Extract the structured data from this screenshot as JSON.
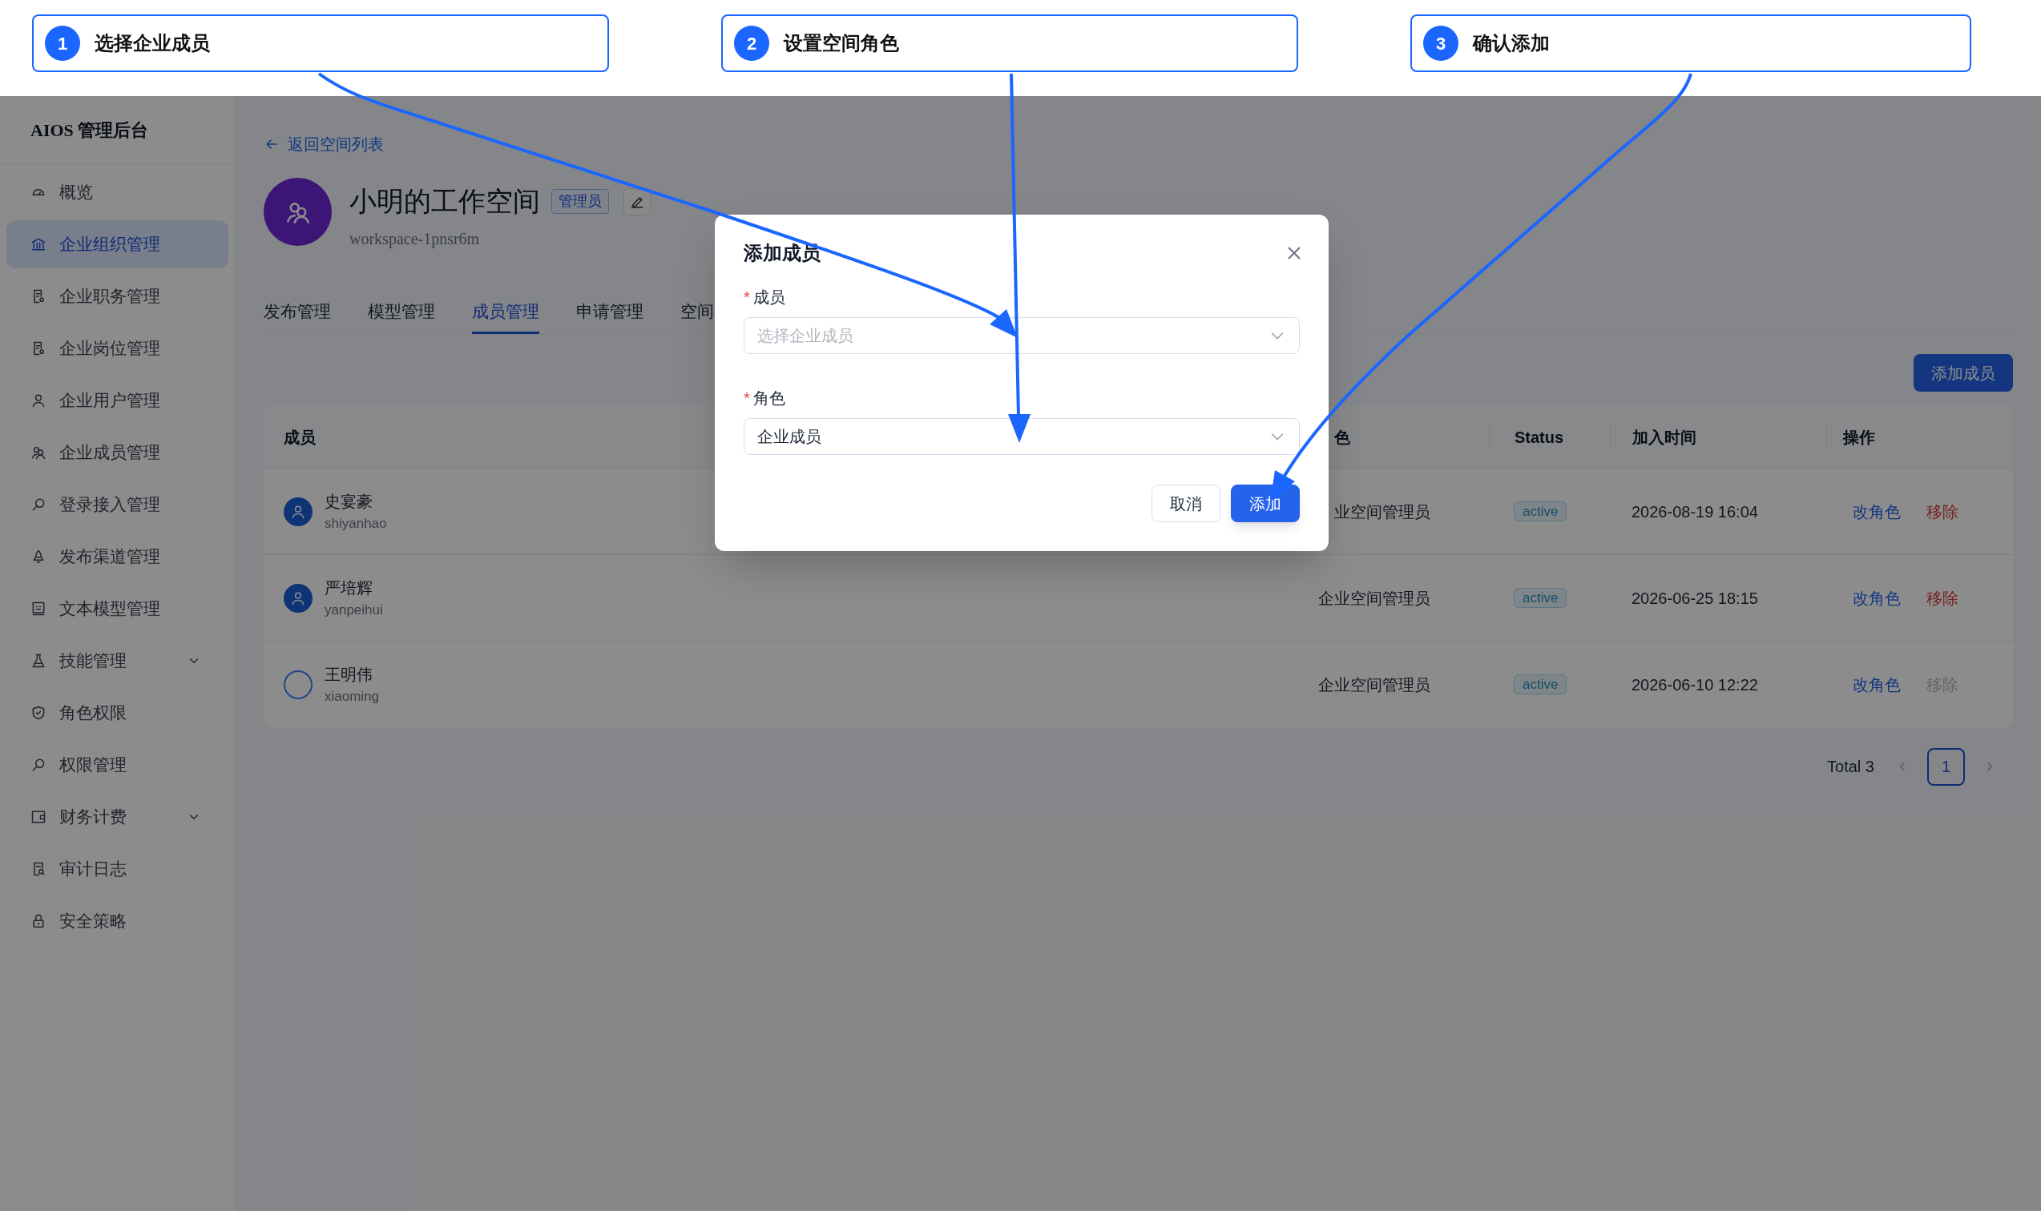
{
  "annotations": [
    {
      "number": "1",
      "label": "选择企业成员"
    },
    {
      "number": "2",
      "label": "设置空间角色"
    },
    {
      "number": "3",
      "label": "确认添加"
    }
  ],
  "sidebar": {
    "title": "AIOS 管理后台",
    "items": [
      {
        "label": "概览",
        "selected": false,
        "has_submenu": false
      },
      {
        "label": "企业组织管理",
        "selected": true,
        "has_submenu": false
      },
      {
        "label": "企业职务管理",
        "selected": false,
        "has_submenu": false
      },
      {
        "label": "企业岗位管理",
        "selected": false,
        "has_submenu": false
      },
      {
        "label": "企业用户管理",
        "selected": false,
        "has_submenu": false
      },
      {
        "label": "企业成员管理",
        "selected": false,
        "has_submenu": false
      },
      {
        "label": "登录接入管理",
        "selected": false,
        "has_submenu": false
      },
      {
        "label": "发布渠道管理",
        "selected": false,
        "has_submenu": false
      },
      {
        "label": "文本模型管理",
        "selected": false,
        "has_submenu": false
      },
      {
        "label": "技能管理",
        "selected": false,
        "has_submenu": true
      },
      {
        "label": "角色权限",
        "selected": false,
        "has_submenu": false
      },
      {
        "label": "权限管理",
        "selected": false,
        "has_submenu": false
      },
      {
        "label": "财务计费",
        "selected": false,
        "has_submenu": true
      },
      {
        "label": "审计日志",
        "selected": false,
        "has_submenu": false
      },
      {
        "label": "安全策略",
        "selected": false,
        "has_submenu": false
      }
    ]
  },
  "back_link": "返回空间列表",
  "workspace": {
    "name": "小明的工作空间",
    "badge": "管理员",
    "id": "workspace-1pnsr6m"
  },
  "tabs": [
    {
      "label": "发布管理",
      "selected": false
    },
    {
      "label": "模型管理",
      "selected": false
    },
    {
      "label": "成员管理",
      "selected": true
    },
    {
      "label": "申请管理",
      "selected": false
    },
    {
      "label": "空间",
      "selected": false
    }
  ],
  "add_button": "添加成员",
  "table": {
    "columns": [
      "成员",
      "色",
      "Status",
      "加入时间",
      "操作"
    ],
    "rows": [
      {
        "name": "史宴豪",
        "username": "shiyanhao",
        "avatar_loaded": true,
        "role": "业空间管理员",
        "status": "active",
        "joined": "2026-08-19 16:04",
        "actions": [
          {
            "label": "改角色",
            "kind": "edit",
            "disabled": false
          },
          {
            "label": "移除",
            "kind": "remove",
            "disabled": false
          }
        ]
      },
      {
        "name": "严培辉",
        "username": "yanpeihui",
        "avatar_loaded": true,
        "role": "企业空间管理员",
        "status": "active",
        "joined": "2026-06-25 18:15",
        "actions": [
          {
            "label": "改角色",
            "kind": "edit",
            "disabled": false
          },
          {
            "label": "移除",
            "kind": "remove",
            "disabled": false
          }
        ]
      },
      {
        "name": "王明伟",
        "username": "xiaoming",
        "avatar_loaded": false,
        "role": "企业空间管理员",
        "status": "active",
        "joined": "2026-06-10 12:22",
        "actions": [
          {
            "label": "改角色",
            "kind": "edit",
            "disabled": false
          },
          {
            "label": "移除",
            "kind": "remove",
            "disabled": true
          }
        ]
      }
    ]
  },
  "pagination": {
    "total": "Total 3",
    "pages": [
      {
        "label": "1",
        "selected": true
      }
    ]
  },
  "modal": {
    "title": "添加成员",
    "fields": [
      {
        "label": "成员",
        "required_mark": "*",
        "placeholder": "选择企业成员"
      },
      {
        "label": "角色",
        "required_mark": "*",
        "value": "企业成员"
      }
    ],
    "buttons": [
      {
        "label": "取消",
        "kind": "secondary"
      },
      {
        "label": "添加",
        "kind": "primary"
      }
    ]
  }
}
